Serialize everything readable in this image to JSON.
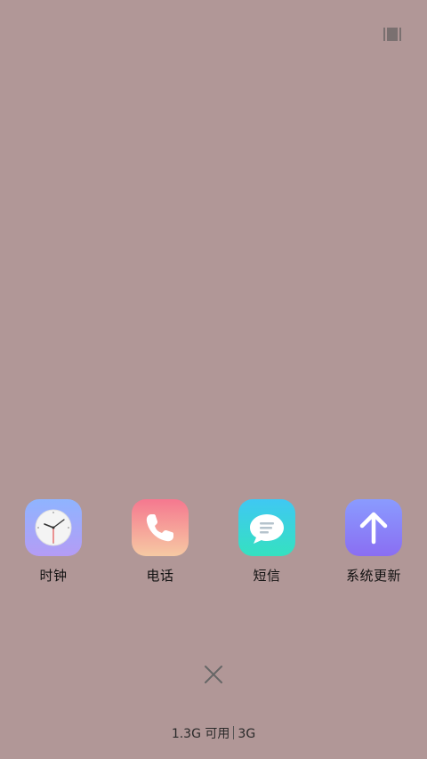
{
  "apps": [
    {
      "label": "时钟",
      "icon": "clock-icon"
    },
    {
      "label": "电话",
      "icon": "phone-icon"
    },
    {
      "label": "短信",
      "icon": "message-icon"
    },
    {
      "label": "系统更新",
      "icon": "system-update-icon"
    }
  ],
  "memory": {
    "available_label": "1.3G 可用",
    "total_label": "3G"
  },
  "colors": {
    "background": "#b19797",
    "clock_gradient_top": "#8fb4ff",
    "clock_gradient_bottom": "#b49cf5",
    "phone_gradient_top": "#f5788f",
    "phone_gradient_bottom": "#f6c9a3",
    "message_gradient_top": "#3fc8f3",
    "message_gradient_bottom": "#35e1c0",
    "update_gradient_top": "#8a9bff",
    "update_gradient_bottom": "#8a6ef2"
  }
}
